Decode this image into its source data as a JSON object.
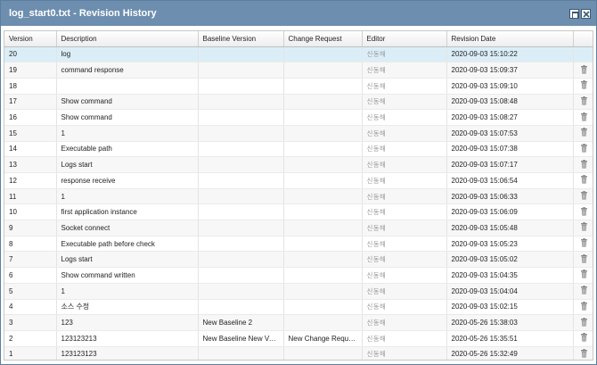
{
  "window": {
    "title": "log_start0.txt - Revision History"
  },
  "columns": [
    "Version",
    "Description",
    "Baseline Version",
    "Change Request",
    "Editor",
    "Revision Date",
    ""
  ],
  "rows": [
    {
      "version": "20",
      "description": "log",
      "baseline": "",
      "change_request": "",
      "editor": "신동해",
      "date": "2020-09-03 15:10:22",
      "deletable": false,
      "selected": true
    },
    {
      "version": "19",
      "description": "command response",
      "baseline": "",
      "change_request": "",
      "editor": "신동해",
      "date": "2020-09-03 15:09:37",
      "deletable": true
    },
    {
      "version": "18",
      "description": "",
      "baseline": "",
      "change_request": "",
      "editor": "신동해",
      "date": "2020-09-03 15:09:10",
      "deletable": true
    },
    {
      "version": "17",
      "description": "Show command",
      "baseline": "",
      "change_request": "",
      "editor": "신동해",
      "date": "2020-09-03 15:08:48",
      "deletable": true
    },
    {
      "version": "16",
      "description": "Show command",
      "baseline": "",
      "change_request": "",
      "editor": "신동해",
      "date": "2020-09-03 15:08:27",
      "deletable": true
    },
    {
      "version": "15",
      "description": "1",
      "baseline": "",
      "change_request": "",
      "editor": "신동해",
      "date": "2020-09-03 15:07:53",
      "deletable": true
    },
    {
      "version": "14",
      "description": "Executable path",
      "baseline": "",
      "change_request": "",
      "editor": "신동해",
      "date": "2020-09-03 15:07:38",
      "deletable": true
    },
    {
      "version": "13",
      "description": "Logs start",
      "baseline": "",
      "change_request": "",
      "editor": "신동해",
      "date": "2020-09-03 15:07:17",
      "deletable": true
    },
    {
      "version": "12",
      "description": "response receive",
      "baseline": "",
      "change_request": "",
      "editor": "신동해",
      "date": "2020-09-03 15:06:54",
      "deletable": true
    },
    {
      "version": "11",
      "description": "1",
      "baseline": "",
      "change_request": "",
      "editor": "신동해",
      "date": "2020-09-03 15:06:33",
      "deletable": true
    },
    {
      "version": "10",
      "description": "first application instance",
      "baseline": "",
      "change_request": "",
      "editor": "신동해",
      "date": "2020-09-03 15:06:09",
      "deletable": true
    },
    {
      "version": "9",
      "description": "Socket connect",
      "baseline": "",
      "change_request": "",
      "editor": "신동해",
      "date": "2020-09-03 15:05:48",
      "deletable": true
    },
    {
      "version": "8",
      "description": "Executable path before check",
      "baseline": "",
      "change_request": "",
      "editor": "신동해",
      "date": "2020-09-03 15:05:23",
      "deletable": true
    },
    {
      "version": "7",
      "description": "Logs start",
      "baseline": "",
      "change_request": "",
      "editor": "신동해",
      "date": "2020-09-03 15:05:02",
      "deletable": true
    },
    {
      "version": "6",
      "description": "Show command written",
      "baseline": "",
      "change_request": "",
      "editor": "신동해",
      "date": "2020-09-03 15:04:35",
      "deletable": true
    },
    {
      "version": "5",
      "description": "1",
      "baseline": "",
      "change_request": "",
      "editor": "신동해",
      "date": "2020-09-03 15:04:04",
      "deletable": true
    },
    {
      "version": "4",
      "description": "소스 수정",
      "baseline": "",
      "change_request": "",
      "editor": "신동해",
      "date": "2020-09-03 15:02:15",
      "deletable": true
    },
    {
      "version": "3",
      "description": "123",
      "baseline": "New Baseline 2",
      "change_request": "",
      "editor": "신동해",
      "date": "2020-05-26 15:38:03",
      "deletable": true
    },
    {
      "version": "2",
      "description": "123123213",
      "baseline": "New Baseline New Ve...",
      "change_request": "New Change Request",
      "editor": "신동해",
      "date": "2020-05-26 15:35:51",
      "deletable": true
    },
    {
      "version": "1",
      "description": "123123123",
      "baseline": "",
      "change_request": "",
      "editor": "신동해",
      "date": "2020-05-26 15:32:49",
      "deletable": true
    }
  ],
  "icons": {
    "maximize": "maximize-icon",
    "close": "close-icon",
    "delete": "trash-icon"
  },
  "colors": {
    "titlebar": "#6d8eae",
    "selected_row": "#dbeef8",
    "alt_row": "#f7f7f7"
  }
}
